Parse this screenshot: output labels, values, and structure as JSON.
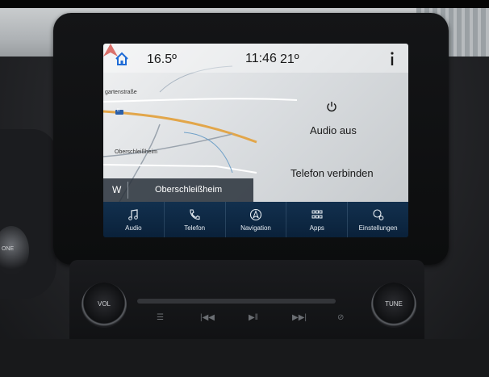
{
  "status_bar": {
    "outside_temp": "16.5º",
    "clock": "11:46",
    "cabin_temp": "21º"
  },
  "map": {
    "street_labels": [
      "gartenstraße",
      "Oberschleißheim"
    ],
    "road_shield": "B"
  },
  "location_bar": {
    "heading": "W",
    "place": "Oberschleißheim"
  },
  "widgets": {
    "audio_status": "Audio aus",
    "phone_status": "Telefon verbinden"
  },
  "menu": [
    {
      "label": "Audio",
      "icon": "music-note-icon"
    },
    {
      "label": "Telefon",
      "icon": "phone-icon"
    },
    {
      "label": "Navigation",
      "icon": "compass-icon"
    },
    {
      "label": "Apps",
      "icon": "apps-grid-icon"
    },
    {
      "label": "Einstellungen",
      "icon": "settings-gear-icon"
    }
  ],
  "hardware": {
    "vol_label": "VOL",
    "tune_label": "TUNE",
    "left_knob_label": "ONE"
  },
  "colors": {
    "menu_bar": "#0a213a",
    "nav_arrow": "#c8261e",
    "home_icon": "#1e6bd6"
  }
}
